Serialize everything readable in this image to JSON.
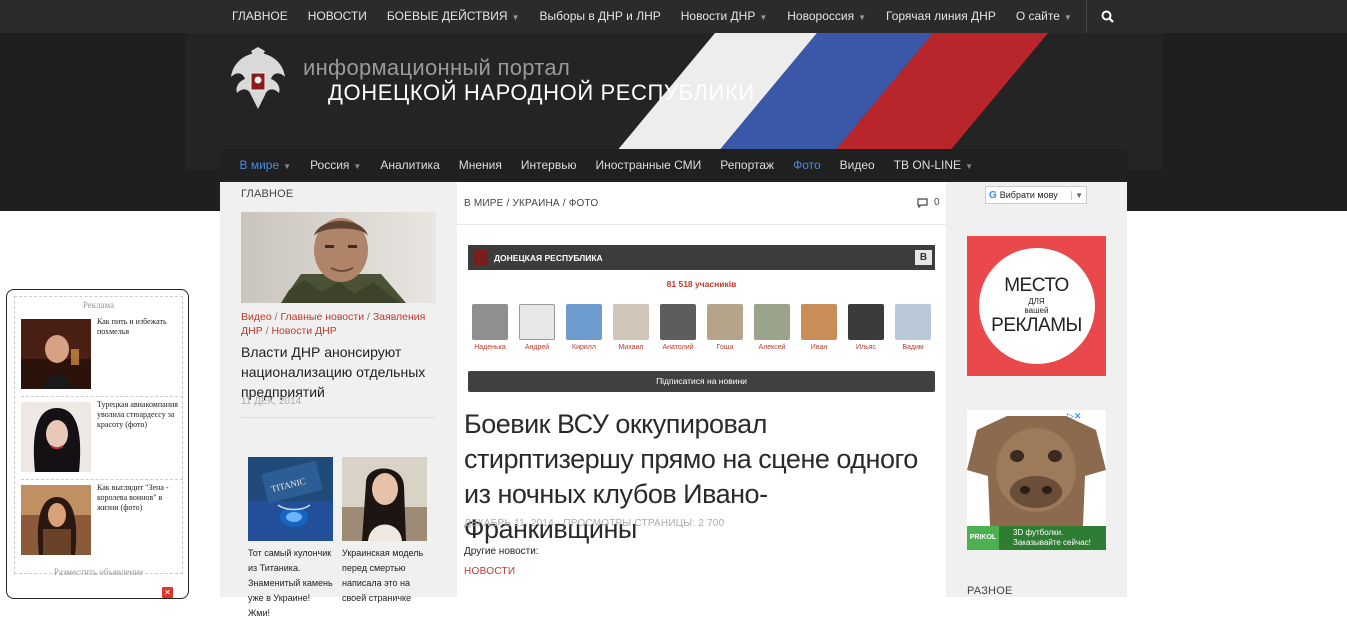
{
  "top_nav": {
    "items": [
      {
        "label": "ГЛАВНОЕ",
        "has_dropdown": false
      },
      {
        "label": "НОВОСТИ",
        "has_dropdown": false
      },
      {
        "label": "БОЕВЫЕ ДЕЙСТВИЯ",
        "has_dropdown": true
      },
      {
        "label": "Выборы в ДНР и ЛНР",
        "has_dropdown": false
      },
      {
        "label": "Новости ДНР",
        "has_dropdown": true
      },
      {
        "label": "Новороссия",
        "has_dropdown": true
      },
      {
        "label": "Горячая линия ДНР",
        "has_dropdown": false
      },
      {
        "label": "О сайте",
        "has_dropdown": true
      }
    ],
    "search_icon": "search-icon"
  },
  "header": {
    "line1": "информационный портал",
    "line2": "ДОНЕЦКОЙ НАРОДНОЙ РЕСПУБЛИКИ",
    "flag_colors": [
      "#ffffff",
      "#3a57a8",
      "#b8262b"
    ]
  },
  "sub_nav": {
    "items": [
      {
        "label": "В мире",
        "has_dropdown": true,
        "active": true
      },
      {
        "label": "Россия",
        "has_dropdown": true,
        "active": false
      },
      {
        "label": "Аналитика",
        "has_dropdown": false,
        "active": false
      },
      {
        "label": "Мнения",
        "has_dropdown": false,
        "active": false
      },
      {
        "label": "Интервью",
        "has_dropdown": false,
        "active": false
      },
      {
        "label": "Иностранные СМИ",
        "has_dropdown": false,
        "active": false
      },
      {
        "label": "Репортаж",
        "has_dropdown": false,
        "active": false
      },
      {
        "label": "Фото",
        "has_dropdown": false,
        "active": true
      },
      {
        "label": "Видео",
        "has_dropdown": false,
        "active": false
      },
      {
        "label": "ТВ ON-LINE",
        "has_dropdown": true,
        "active": false
      }
    ]
  },
  "left": {
    "section_title": "ГЛАВНОЕ",
    "feature": {
      "cat1": "Видео",
      "cat2": "Главные новости",
      "cat3": "Заявления ДНР",
      "cat4": "Новости ДНР",
      "title": "Власти ДНР анонсируют национализацию отдельных предприятий",
      "date": "11 ДЕК, 2014"
    },
    "promos": [
      {
        "caption": "Тот самый кулончик из Титаника. Знаменитый камень уже в Украине! Жми!",
        "pic_label": "TITANIC"
      },
      {
        "caption": "Украинская модель перед смертью написала это на своей страничке"
      }
    ]
  },
  "center": {
    "breadcrumb": {
      "a": "В МИРЕ",
      "b": "УКРАИНА",
      "c": "ФОТО"
    },
    "comments_count": "0",
    "vk": {
      "group_name": "ДОНЕЦКАЯ РЕСПУБЛИКА",
      "vk_button": "В",
      "members_count": "81 518 учасників",
      "members": [
        {
          "name": "Наденька",
          "color": "#8f8f8f"
        },
        {
          "name": "Андрей",
          "color": "#e8e8e8"
        },
        {
          "name": "Кирилл",
          "color": "#6f9ccf"
        },
        {
          "name": "Михаил",
          "color": "#cfc6b8"
        },
        {
          "name": "Анатолий",
          "color": "#5d5d5d"
        },
        {
          "name": "Гоша",
          "color": "#b5a48a"
        },
        {
          "name": "Алексей",
          "color": "#9aa38c"
        },
        {
          "name": "Иван",
          "color": "#c98d58"
        },
        {
          "name": "Ильяс",
          "color": "#3b3b3b"
        },
        {
          "name": "Вадим",
          "color": "#b9c8d9"
        }
      ],
      "subscribe_label": "Підписатися на новини"
    },
    "headline": "Боевик ВСУ оккупировал стирптизершу прямо на сцене одного из ночных клубов Ивано-Франкивщины",
    "meta": "ДЕКАБРЬ 11, 2014 · ПРОСМОТРЫ СТРАНИЦЫ: 2 700",
    "other_news_label": "Другие новости:",
    "news_link": "НОВОСТИ"
  },
  "right": {
    "translate_label": "Вибрати мову",
    "ad1": {
      "line1": "МЕСТО",
      "line2": "ДЛЯ",
      "line3": "вашей",
      "line4": "РЕКЛАМЫ"
    },
    "ad2": {
      "logo": "PRIKOL",
      "text1": "3D футболки.",
      "text2": "Заказывайте сейчас!"
    },
    "section_title": "РАЗНОЕ"
  },
  "float_ad": {
    "title": "Реклама",
    "items": [
      {
        "text": "Как пить и избежать похмелья"
      },
      {
        "text": "Турецкая авиакомпания уволила стюардессу за красоту (фото)"
      },
      {
        "text": "Как выглядит \"Зена - королева воинов\" в жизни (фото)"
      }
    ],
    "post_label": "Разместить объявление",
    "close_icon": "close-icon"
  }
}
